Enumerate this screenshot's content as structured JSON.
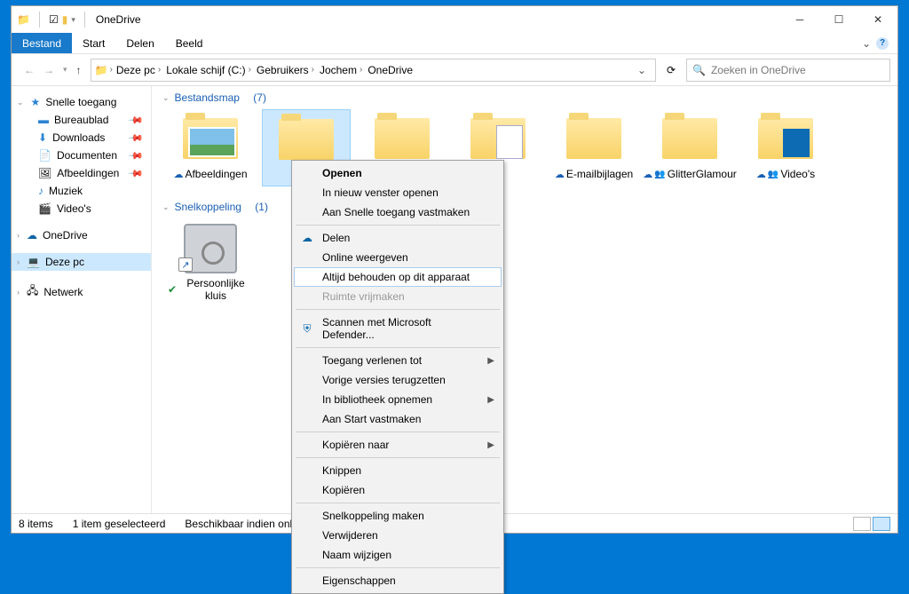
{
  "window": {
    "title": "OneDrive"
  },
  "ribbon": {
    "file": "Bestand",
    "tabs": [
      "Start",
      "Delen",
      "Beeld"
    ]
  },
  "breadcrumb": [
    "Deze pc",
    "Lokale schijf (C:)",
    "Gebruikers",
    "Jochem",
    "OneDrive"
  ],
  "search": {
    "placeholder": "Zoeken in OneDrive"
  },
  "sidebar": {
    "quick": "Snelle toegang",
    "quick_items": [
      "Bureaublad",
      "Downloads",
      "Documenten",
      "Afbeeldingen",
      "Muziek",
      "Video's"
    ],
    "onedrive": "OneDrive",
    "thispc": "Deze pc",
    "network": "Netwerk"
  },
  "groups": {
    "folders": {
      "label": "Bestandsmap",
      "count": "(7)",
      "items": [
        "Afbeeldingen",
        "",
        "",
        "",
        "E-mailbijlagen",
        "GlitterGlamour",
        "Video's"
      ]
    },
    "shortcuts": {
      "label": "Snelkoppeling",
      "count": "(1)",
      "items": [
        "Persoonlijke kluis"
      ]
    }
  },
  "status": {
    "count": "8 items",
    "selection": "1 item geselecteerd",
    "availability": "Beschikbaar indien online"
  },
  "ctx": {
    "open": "Openen",
    "newwin": "In nieuw venster openen",
    "pinquick": "Aan Snelle toegang vastmaken",
    "share": "Delen",
    "viewonline": "Online weergeven",
    "keep": "Altijd behouden op dit apparaat",
    "free": "Ruimte vrijmaken",
    "defender": "Scannen met Microsoft Defender...",
    "grant": "Toegang verlenen tot",
    "restore": "Vorige versies terugzetten",
    "library": "In bibliotheek opnemen",
    "pinstart": "Aan Start vastmaken",
    "copyto": "Kopiëren naar",
    "cut": "Knippen",
    "copy": "Kopiëren",
    "shortcut": "Snelkoppeling maken",
    "delete": "Verwijderen",
    "rename": "Naam wijzigen",
    "props": "Eigenschappen"
  }
}
